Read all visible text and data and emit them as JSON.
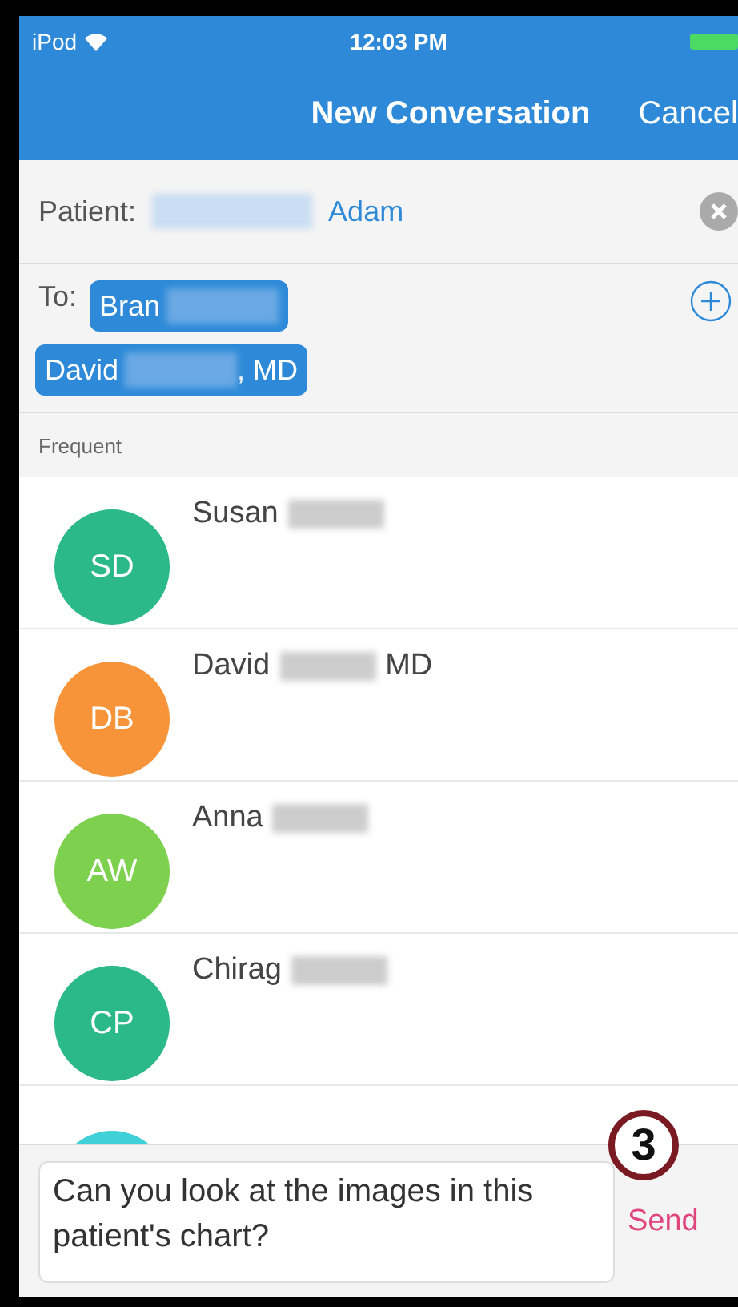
{
  "status_bar": {
    "carrier": "iPod",
    "time": "12:03 PM"
  },
  "nav_bar": {
    "title": "New Conversation",
    "cancel": "Cancel"
  },
  "patient": {
    "label": "Patient:",
    "name": "Adam"
  },
  "recipients": {
    "label": "To:",
    "chips": [
      {
        "first": "Bran"
      },
      {
        "first": "David",
        "suffix": ", MD"
      }
    ]
  },
  "section_header": "Frequent",
  "contacts": [
    {
      "initials": "SD",
      "color": "#2bb98a",
      "first": "Susan"
    },
    {
      "initials": "DB",
      "color": "#f7943a",
      "first": "David",
      "suffix": "MD"
    },
    {
      "initials": "AW",
      "color": "#7ed04f",
      "first": "Anna"
    },
    {
      "initials": "CP",
      "color": "#2bb98a",
      "first": "Chirag"
    },
    {
      "color": "#3fd0d8"
    }
  ],
  "annotation": "3",
  "composer": {
    "value": "Can you look at the images in this patient's chart?",
    "send": "Send"
  }
}
